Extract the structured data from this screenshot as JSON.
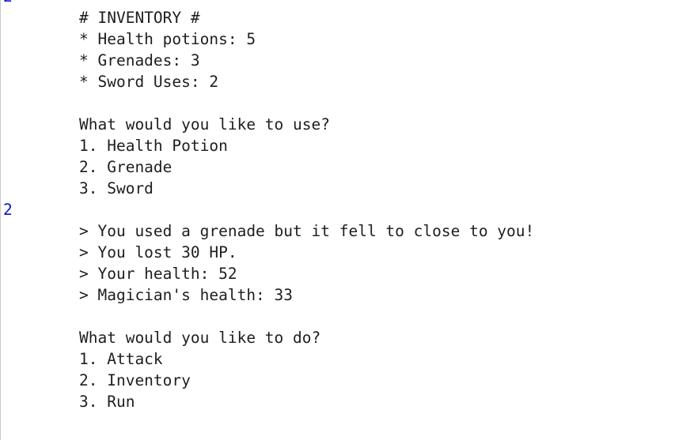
{
  "console": {
    "input_top": "2",
    "inventory_header": "# INVENTORY #",
    "inventory_items": [
      "* Health potions: 5",
      "* Grenades: 3",
      "* Sword Uses: 2"
    ],
    "use_prompt": "What would you like to use?",
    "use_options": [
      "1. Health Potion",
      "2. Grenade",
      "3. Sword"
    ],
    "input_choice": "2",
    "result_lines": [
      "> You used a grenade but it fell to close to you!",
      "> You lost 30 HP.",
      "> Your health: 52",
      "> Magician's health: 33"
    ],
    "do_prompt": "What would you like to do?",
    "do_options": [
      "1. Attack",
      "2. Inventory",
      "3. Run"
    ]
  },
  "colors": {
    "user_input": "#1010d0",
    "output_text": "#1e1e1e",
    "background": "#ffffff"
  }
}
